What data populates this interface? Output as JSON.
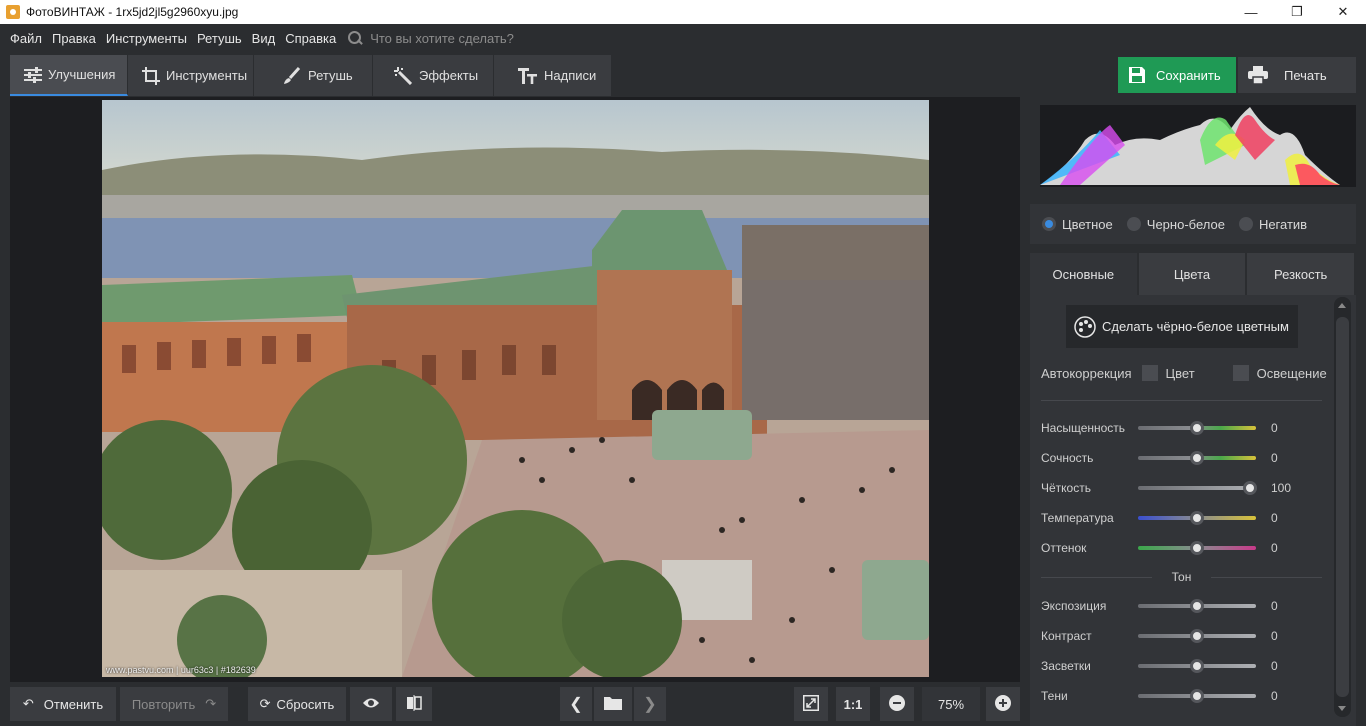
{
  "window": {
    "title": "ФотоВИНТАЖ - 1rx5jd2jl5g2960xyu.jpg"
  },
  "menu": {
    "items": [
      "Файл",
      "Правка",
      "Инструменты",
      "Ретушь",
      "Вид",
      "Справка"
    ],
    "search_placeholder": "Что вы хотите сделать?"
  },
  "tabs": [
    {
      "label": "Улучшения",
      "icon": "sliders-icon",
      "active": true
    },
    {
      "label": "Инструменты",
      "icon": "crop-icon",
      "active": false
    },
    {
      "label": "Ретушь",
      "icon": "brush-icon",
      "active": false
    },
    {
      "label": "Эффекты",
      "icon": "magic-wand-icon",
      "active": false
    },
    {
      "label": "Надписи",
      "icon": "text-icon",
      "active": false
    }
  ],
  "actions": {
    "save": "Сохранить",
    "print": "Печать"
  },
  "photo": {
    "watermark": "www.pastvu.com | uur63c3 | #182639"
  },
  "color_mode": {
    "options": [
      "Цветное",
      "Черно-белое",
      "Негатив"
    ],
    "selected": "Цветное"
  },
  "panel_tabs": [
    "Основные",
    "Цвета",
    "Резкость"
  ],
  "colorize_button": "Сделать чёрно-белое цветным",
  "autocorrection": {
    "label": "Автокоррекция",
    "options": [
      "Цвет",
      "Освещение"
    ]
  },
  "sliders": [
    {
      "label": "Насыщенность",
      "value": "0",
      "position": 0.5
    },
    {
      "label": "Сочность",
      "value": "0",
      "position": 0.5
    },
    {
      "label": "Чёткость",
      "value": "100",
      "position": 0.95
    },
    {
      "label": "Температура",
      "value": "0",
      "position": 0.5
    },
    {
      "label": "Оттенок",
      "value": "0",
      "position": 0.5
    }
  ],
  "tone": {
    "header": "Тон",
    "sliders": [
      {
        "label": "Экспозиция",
        "value": "0",
        "position": 0.5
      },
      {
        "label": "Контраст",
        "value": "0",
        "position": 0.5
      },
      {
        "label": "Засветки",
        "value": "0",
        "position": 0.5
      },
      {
        "label": "Тени",
        "value": "0",
        "position": 0.5
      }
    ]
  },
  "bottom": {
    "undo": "Отменить",
    "redo": "Повторить",
    "reset": "Сбросить",
    "ratio": "1:1",
    "zoom": "75%"
  },
  "colors": {
    "accent": "#3a8be0",
    "save_green": "#1f9a55",
    "bg": "#2b2d30"
  }
}
